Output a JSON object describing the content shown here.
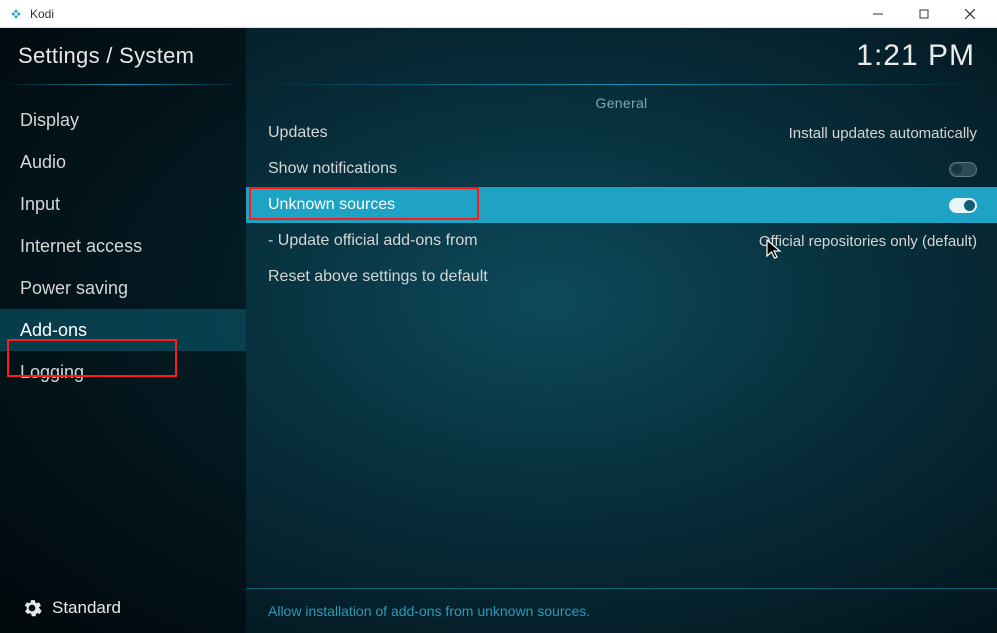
{
  "window": {
    "title": "Kodi"
  },
  "header": {
    "breadcrumb": "Settings / System",
    "time": "1:21 PM"
  },
  "sidebar": {
    "items": [
      {
        "label": "Display"
      },
      {
        "label": "Audio"
      },
      {
        "label": "Input"
      },
      {
        "label": "Internet access"
      },
      {
        "label": "Power saving"
      },
      {
        "label": "Add-ons"
      },
      {
        "label": "Logging"
      }
    ],
    "active_index": 5,
    "level_label": "Standard"
  },
  "main": {
    "section": "General",
    "rows": [
      {
        "label": "Updates",
        "value": "Install updates automatically"
      },
      {
        "label": "Show notifications",
        "toggle": "off"
      },
      {
        "label": "Unknown sources",
        "toggle": "on",
        "highlighted": true
      },
      {
        "label": "Update official add-ons from",
        "value": "Official repositories only (default)",
        "indent": true
      },
      {
        "label": "Reset above settings to default"
      }
    ],
    "hover_index": 2,
    "help_text": "Allow installation of add-ons from unknown sources."
  }
}
